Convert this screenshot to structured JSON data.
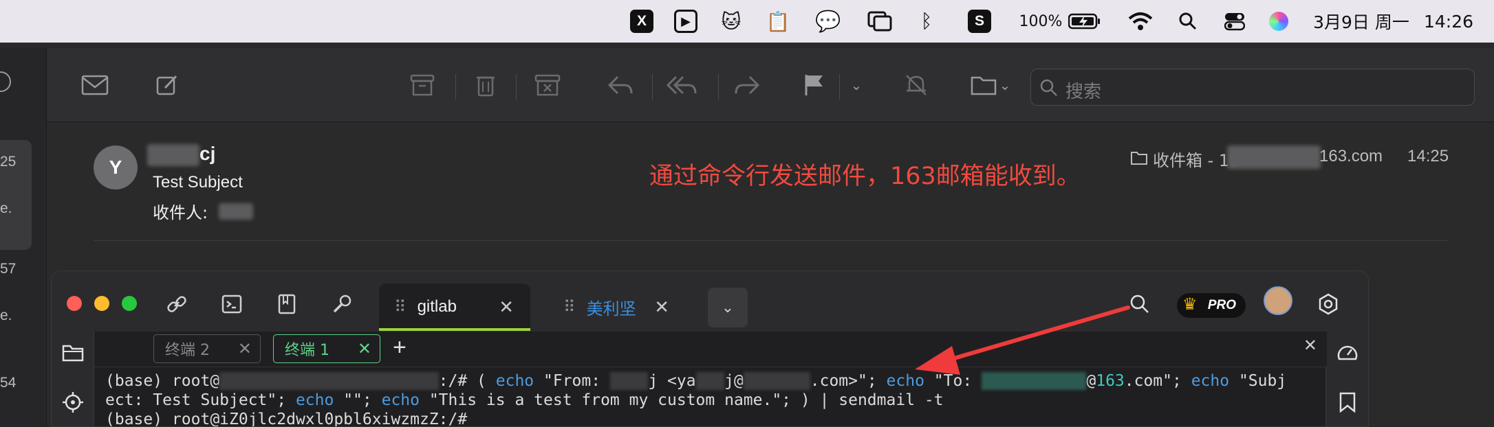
{
  "menubar": {
    "app_icons": [
      "x-app-icon",
      "media-app-icon",
      "cat-app-icon",
      "clipboard-icon",
      "wechat-icon",
      "windows-icon",
      "bluetooth-icon",
      "s-app-icon"
    ],
    "battery": "100%",
    "date": "3月9日 周一",
    "time": "14:26"
  },
  "mail": {
    "toolbar_icons": [
      "envelope-icon",
      "compose-icon",
      "archive-icon",
      "trash-icon",
      "junk-icon",
      "reply-icon",
      "reply-all-icon",
      "forward-icon",
      "flag-icon",
      "mute-icon",
      "folder-icon"
    ],
    "search_placeholder": "搜索",
    "sidebar_fragments": [
      "25",
      "e.",
      "57",
      "e.",
      "54"
    ],
    "message": {
      "avatar_initial": "Y",
      "sender_visible": "cj",
      "subject": "Test Subject",
      "recipient_label": "收件人:",
      "folder_prefix": "收件箱 - 18",
      "folder_suffix": "163.com",
      "time": "14:25"
    },
    "annotation": "通过命令行发送邮件，163邮箱能收到。"
  },
  "terminal": {
    "tabs": [
      {
        "label": "gitlab",
        "active": true
      },
      {
        "label": "美利坚",
        "active": false
      }
    ],
    "pro_label": "PRO",
    "subtabs": [
      {
        "label": "终端 2",
        "active": false
      },
      {
        "label": "终端 1",
        "active": true
      }
    ],
    "lines": {
      "l1_prefix": "(base) root@",
      "l1_path": ":/# ( ",
      "echo": "echo",
      "l1_from": " \"From: ",
      "l1_from2": "j <ya",
      "l1_from3": "j@",
      "l1_from4": ".com>\"; ",
      "l1_to": " \"To: ",
      "l1_to2": "@",
      "l1_163": "163",
      "l1_to3": ".com\"; ",
      "l1_subj": " \"Subj",
      "l2_a": "ect: Test Subject\"; ",
      "l2_b": " \"\"; ",
      "l2_c": " \"This is a test from my custom name.\"; ) | sendmail -t",
      "l3": "(base) root@iZ0jlc2dwxl0pbl6xiwzmzZ:/# "
    }
  }
}
